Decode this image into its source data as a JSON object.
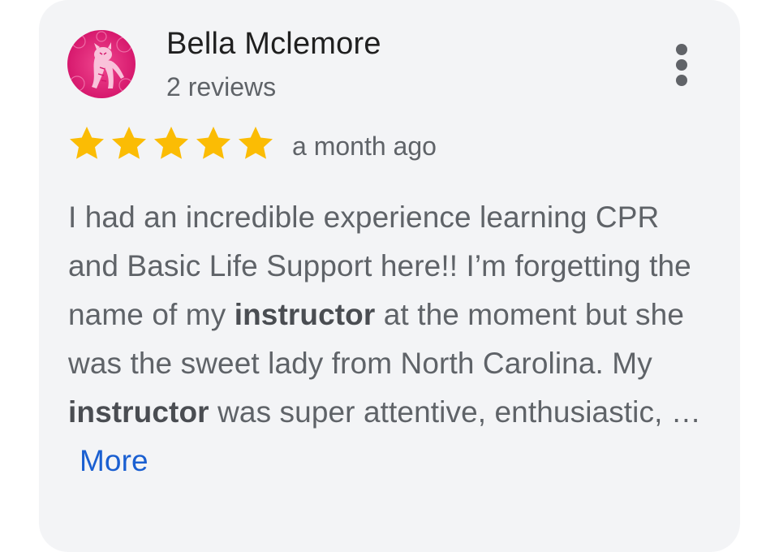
{
  "review": {
    "author_name": "Bella Mclemore",
    "author_review_count": "2 reviews",
    "avatar": {
      "icon": "tiger-avatar-icon",
      "colors": {
        "background": "#e21a76",
        "figure": "#f7b3cf"
      }
    },
    "menu_icon": "more-vert-icon",
    "rating": {
      "value": 5,
      "max": 5,
      "star_color": "#fbbc04"
    },
    "time_ago": "a month ago",
    "text_segments": [
      "I had an incredible experience learning CPR and Basic Life Support here!! I’m forgetting the name of my ",
      "instructor",
      " at the moment but she was the sweet lady from North Carolina. My ",
      "instructor",
      " was super attentive, enthusiastic, … "
    ],
    "more_label": "More",
    "colors": {
      "card_background": "#f3f4f6",
      "link": "#1a5fd1",
      "text_secondary": "#5f6368",
      "text_primary": "#1f1f1f"
    }
  }
}
